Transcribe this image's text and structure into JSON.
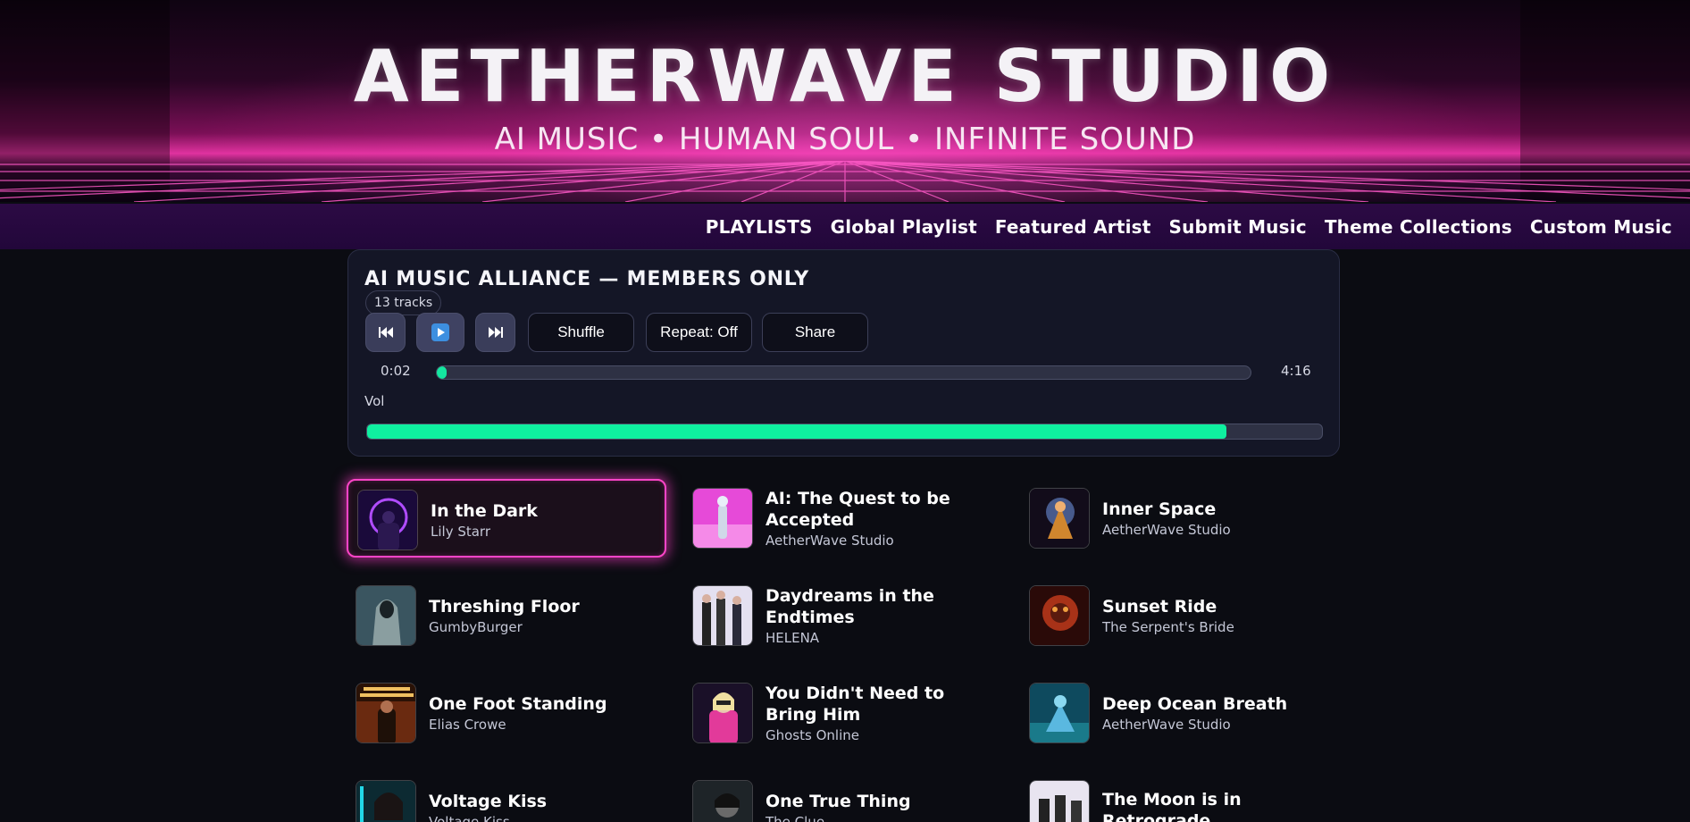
{
  "hero": {
    "title": "AETHERWAVE STUDIO",
    "tagline": "AI MUSIC  •  HUMAN SOUL  •  INFINITE SOUND"
  },
  "nav": {
    "items": [
      "PLAYLISTS",
      "Global Playlist",
      "Featured Artist",
      "Submit Music",
      "Theme Collections",
      "Custom Music"
    ]
  },
  "player": {
    "title": "AI MUSIC ALLIANCE — MEMBERS ONLY",
    "track_count": "13 tracks",
    "controls": {
      "prev_icon": "skip-back-icon",
      "play_icon": "play-icon",
      "next_icon": "skip-forward-icon",
      "shuffle_label": "Shuffle",
      "repeat_label": "Repeat: Off",
      "share_label": "Share"
    },
    "current_time": "0:02",
    "duration": "4:16",
    "progress_fraction": 0.008,
    "volume_label": "Vol",
    "volume_fraction": 0.9
  },
  "colors": {
    "accent_green": "#14e6a0",
    "active_glow": "#ff45c8",
    "nav_bg": "#2c0a44",
    "page_bg": "#0b0c12"
  },
  "tracks": [
    {
      "title": "In the Dark",
      "artist": "Lily Starr",
      "active": true
    },
    {
      "title": "AI: The Quest to be Accepted",
      "artist": "AetherWave Studio"
    },
    {
      "title": "Inner Space",
      "artist": "AetherWave Studio"
    },
    {
      "title": "Threshing Floor",
      "artist": "GumbyBurger"
    },
    {
      "title": "Daydreams in the Endtimes",
      "artist": "HELENA"
    },
    {
      "title": "Sunset Ride",
      "artist": "The Serpent's Bride"
    },
    {
      "title": "One Foot Standing",
      "artist": "Elias Crowe"
    },
    {
      "title": "You Didn't Need to Bring Him",
      "artist": "Ghosts Online"
    },
    {
      "title": "Deep Ocean Breath",
      "artist": "AetherWave Studio"
    },
    {
      "title": "Voltage Kiss",
      "artist": "Voltage Kiss"
    },
    {
      "title": "One True Thing",
      "artist": "The Clue"
    },
    {
      "title": "The Moon is in Retrograde",
      "artist": ""
    }
  ]
}
